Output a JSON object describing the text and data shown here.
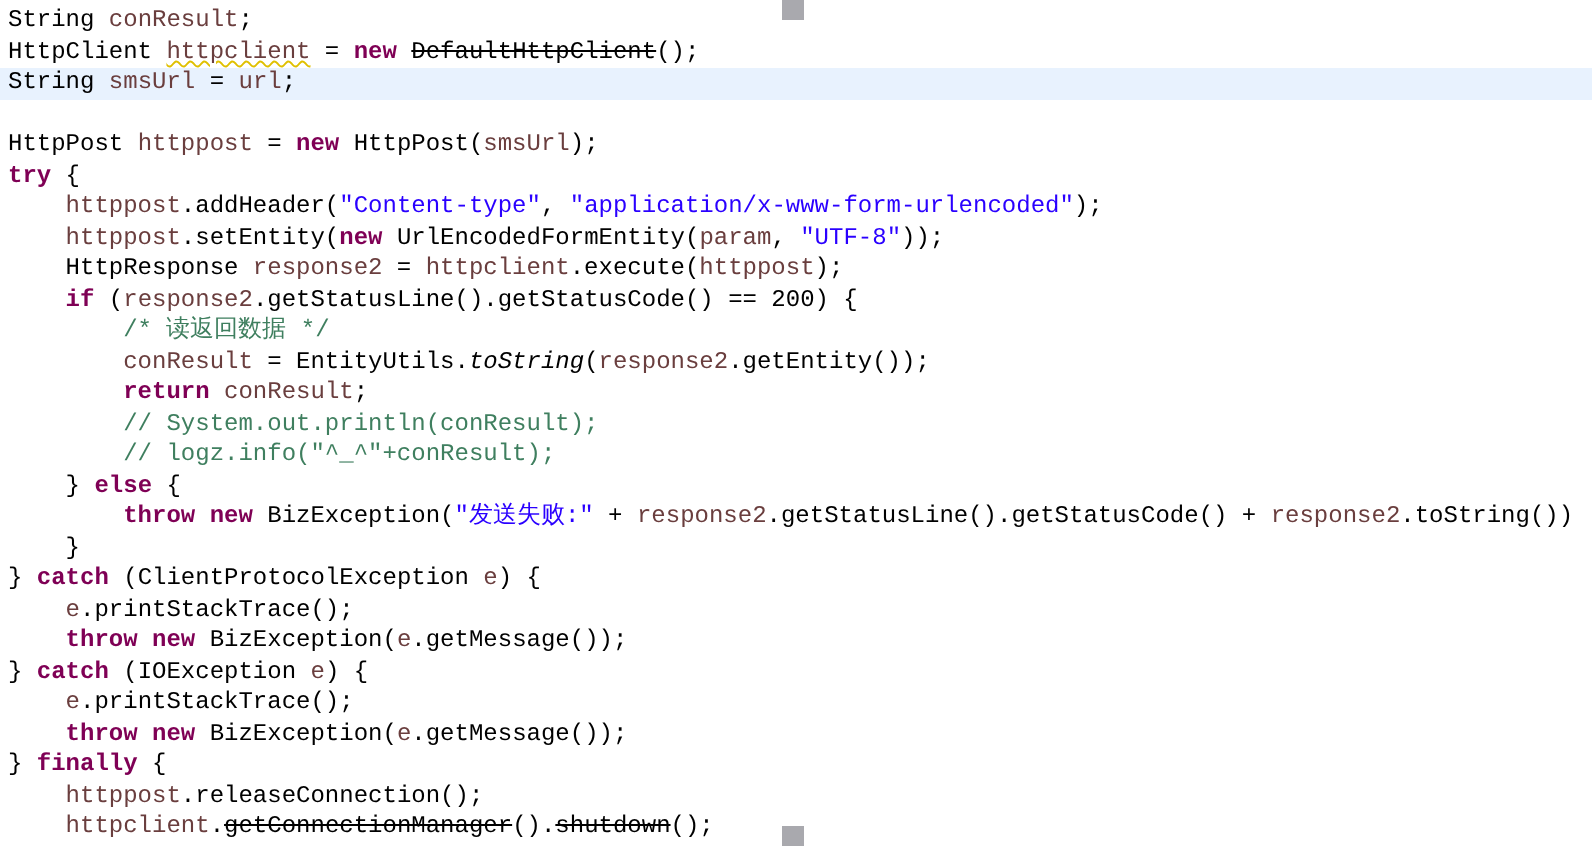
{
  "editor": {
    "lines": [
      {
        "highlighted": false,
        "tokens": [
          {
            "kind": "plain",
            "text": "String "
          },
          {
            "kind": "var",
            "text": "conResult"
          },
          {
            "kind": "plain",
            "text": ";"
          }
        ]
      },
      {
        "highlighted": false,
        "tokens": [
          {
            "kind": "plain",
            "text": "HttpClient "
          },
          {
            "kind": "warn",
            "text": "httpclient"
          },
          {
            "kind": "plain",
            "text": " = "
          },
          {
            "kind": "kw",
            "text": "new "
          },
          {
            "kind": "deprecated",
            "text": "DefaultHttpClient"
          },
          {
            "kind": "plain",
            "text": "();"
          }
        ]
      },
      {
        "highlighted": true,
        "tokens": [
          {
            "kind": "plain",
            "text": "String "
          },
          {
            "kind": "var",
            "text": "smsUrl"
          },
          {
            "kind": "plain",
            "text": " = "
          },
          {
            "kind": "var",
            "text": "url"
          },
          {
            "kind": "plain",
            "text": ";"
          }
        ]
      },
      {
        "highlighted": false
      },
      {
        "highlighted": false,
        "tokens": [
          {
            "kind": "plain",
            "text": "HttpPost "
          },
          {
            "kind": "var",
            "text": "httppost"
          },
          {
            "kind": "plain",
            "text": " = "
          },
          {
            "kind": "kw",
            "text": "new"
          },
          {
            "kind": "plain",
            "text": " HttpPost("
          },
          {
            "kind": "var",
            "text": "smsUrl"
          },
          {
            "kind": "plain",
            "text": ");"
          }
        ]
      },
      {
        "highlighted": false,
        "tokens": [
          {
            "kind": "kw",
            "text": "try"
          },
          {
            "kind": "plain",
            "text": " {"
          }
        ]
      },
      {
        "highlighted": false,
        "tokens": [
          {
            "kind": "var",
            "text": "    httppost"
          },
          {
            "kind": "plain",
            "text": ".addHeader("
          },
          {
            "kind": "str",
            "text": "\"Content-type\""
          },
          {
            "kind": "plain",
            "text": ", "
          },
          {
            "kind": "str",
            "text": "\"application/x-www-form-urlencoded\""
          },
          {
            "kind": "plain",
            "text": ");"
          }
        ]
      },
      {
        "highlighted": false,
        "tokens": [
          {
            "kind": "var",
            "text": "    httppost"
          },
          {
            "kind": "plain",
            "text": ".setEntity("
          },
          {
            "kind": "kw",
            "text": "new"
          },
          {
            "kind": "plain",
            "text": " UrlEncodedFormEntity("
          },
          {
            "kind": "var",
            "text": "param"
          },
          {
            "kind": "plain",
            "text": ", "
          },
          {
            "kind": "str",
            "text": "\"UTF-8\""
          },
          {
            "kind": "plain",
            "text": "));"
          }
        ]
      },
      {
        "highlighted": false,
        "tokens": [
          {
            "kind": "plain",
            "text": "    HttpResponse "
          },
          {
            "kind": "var",
            "text": "response2"
          },
          {
            "kind": "plain",
            "text": " = "
          },
          {
            "kind": "var",
            "text": "httpclient"
          },
          {
            "kind": "plain",
            "text": ".execute("
          },
          {
            "kind": "var",
            "text": "httppost"
          },
          {
            "kind": "plain",
            "text": ");"
          }
        ]
      },
      {
        "highlighted": false,
        "tokens": [
          {
            "kind": "kw",
            "text": "    if"
          },
          {
            "kind": "plain",
            "text": " ("
          },
          {
            "kind": "var",
            "text": "response2"
          },
          {
            "kind": "plain",
            "text": ".getStatusLine().getStatusCode() == 200) {"
          }
        ]
      },
      {
        "highlighted": false,
        "tokens": [
          {
            "kind": "comment",
            "text": "        /* 读返回数据 */"
          }
        ]
      },
      {
        "highlighted": false,
        "tokens": [
          {
            "kind": "var",
            "text": "        conResult"
          },
          {
            "kind": "plain",
            "text": " = EntityUtils."
          },
          {
            "kind": "static",
            "text": "toString"
          },
          {
            "kind": "plain",
            "text": "("
          },
          {
            "kind": "var",
            "text": "response2"
          },
          {
            "kind": "plain",
            "text": ".getEntity());"
          }
        ]
      },
      {
        "highlighted": false,
        "tokens": [
          {
            "kind": "kw",
            "text": "        return "
          },
          {
            "kind": "var",
            "text": "conResult"
          },
          {
            "kind": "plain",
            "text": ";"
          }
        ]
      },
      {
        "highlighted": false,
        "tokens": [
          {
            "kind": "comment",
            "text": "        // System.out.println(conResult);"
          }
        ]
      },
      {
        "highlighted": false,
        "tokens": [
          {
            "kind": "comment",
            "text": "        // logz.info(\"^_^\"+conResult);"
          }
        ]
      },
      {
        "highlighted": false,
        "tokens": [
          {
            "kind": "plain",
            "text": "    } "
          },
          {
            "kind": "kw",
            "text": "else"
          },
          {
            "kind": "plain",
            "text": " {"
          }
        ]
      },
      {
        "highlighted": false,
        "tokens": [
          {
            "kind": "kw",
            "text": "        throw new"
          },
          {
            "kind": "plain",
            "text": " BizException("
          },
          {
            "kind": "str",
            "text": "\"发送失败:\""
          },
          {
            "kind": "plain",
            "text": " + "
          },
          {
            "kind": "var",
            "text": "response2"
          },
          {
            "kind": "plain",
            "text": ".getStatusLine().getStatusCode() + "
          },
          {
            "kind": "var",
            "text": "response2"
          },
          {
            "kind": "plain",
            "text": ".toString())"
          }
        ]
      },
      {
        "highlighted": false,
        "tokens": [
          {
            "kind": "plain",
            "text": "    }"
          }
        ]
      },
      {
        "highlighted": false,
        "tokens": [
          {
            "kind": "plain",
            "text": "} "
          },
          {
            "kind": "kw",
            "text": "catch"
          },
          {
            "kind": "plain",
            "text": " (ClientProtocolException "
          },
          {
            "kind": "var",
            "text": "e"
          },
          {
            "kind": "plain",
            "text": ") {"
          }
        ]
      },
      {
        "highlighted": false,
        "tokens": [
          {
            "kind": "var",
            "text": "    e"
          },
          {
            "kind": "plain",
            "text": ".printStackTrace();"
          }
        ]
      },
      {
        "highlighted": false,
        "tokens": [
          {
            "kind": "kw",
            "text": "    throw new"
          },
          {
            "kind": "plain",
            "text": " BizException("
          },
          {
            "kind": "var",
            "text": "e"
          },
          {
            "kind": "plain",
            "text": ".getMessage());"
          }
        ]
      },
      {
        "highlighted": false,
        "tokens": [
          {
            "kind": "plain",
            "text": "} "
          },
          {
            "kind": "kw",
            "text": "catch"
          },
          {
            "kind": "plain",
            "text": " (IOException "
          },
          {
            "kind": "var",
            "text": "e"
          },
          {
            "kind": "plain",
            "text": ") {"
          }
        ]
      },
      {
        "highlighted": false,
        "tokens": [
          {
            "kind": "var",
            "text": "    e"
          },
          {
            "kind": "plain",
            "text": ".printStackTrace();"
          }
        ]
      },
      {
        "highlighted": false,
        "tokens": [
          {
            "kind": "kw",
            "text": "    throw new"
          },
          {
            "kind": "plain",
            "text": " BizException("
          },
          {
            "kind": "var",
            "text": "e"
          },
          {
            "kind": "plain",
            "text": ".getMessage());"
          }
        ]
      },
      {
        "highlighted": false,
        "tokens": [
          {
            "kind": "plain",
            "text": "} "
          },
          {
            "kind": "kw",
            "text": "finally"
          },
          {
            "kind": "plain",
            "text": " {"
          }
        ]
      },
      {
        "highlighted": false,
        "tokens": [
          {
            "kind": "var",
            "text": "    httppost"
          },
          {
            "kind": "plain",
            "text": ".releaseConnection();"
          }
        ]
      },
      {
        "highlighted": false,
        "tokens": [
          {
            "kind": "var",
            "text": "    httpclient"
          },
          {
            "kind": "plain",
            "text": "."
          },
          {
            "kind": "deprecated",
            "text": "getConnectionManager"
          },
          {
            "kind": "plain",
            "text": "()."
          },
          {
            "kind": "deprecated",
            "text": "shutdown"
          },
          {
            "kind": "plain",
            "text": "();"
          }
        ]
      }
    ]
  }
}
